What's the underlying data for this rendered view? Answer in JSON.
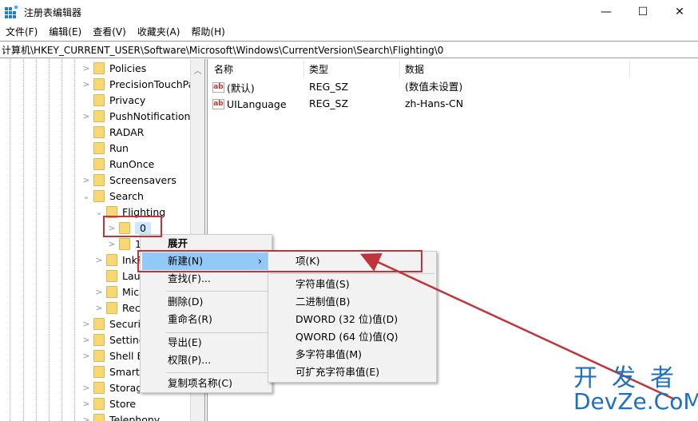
{
  "window": {
    "title": "注册表编辑器",
    "icon": "regedit-icon",
    "controls": {
      "minimize": "—",
      "maximize": "☐",
      "close": "✕"
    }
  },
  "menubar": [
    "文件(F)",
    "编辑(E)",
    "查看(V)",
    "收藏夹(A)",
    "帮助(H)"
  ],
  "address": "计算机\\HKEY_CURRENT_USER\\Software\\Microsoft\\Windows\\CurrentVersion\\Search\\Flighting\\0",
  "tree": {
    "items": [
      {
        "label": "Policies",
        "expander": ">",
        "level": 0
      },
      {
        "label": "PrecisionTouchPa",
        "expander": ">",
        "level": 0
      },
      {
        "label": "Privacy",
        "expander": "",
        "level": 0
      },
      {
        "label": "PushNotifications",
        "expander": ">",
        "level": 0
      },
      {
        "label": "RADAR",
        "expander": "",
        "level": 0
      },
      {
        "label": "Run",
        "expander": "",
        "level": 0
      },
      {
        "label": "RunOnce",
        "expander": "",
        "level": 0
      },
      {
        "label": "Screensavers",
        "expander": ">",
        "level": 0
      },
      {
        "label": "Search",
        "expander": "v",
        "level": 0
      },
      {
        "label": "Flighting",
        "expander": "v",
        "level": 1
      },
      {
        "label": "0",
        "expander": ">",
        "level": 2,
        "selected": true
      },
      {
        "label": "1",
        "expander": ">",
        "level": 2
      },
      {
        "label": "InkR",
        "expander": ">",
        "level": 1
      },
      {
        "label": "Laun",
        "expander": "",
        "level": 1
      },
      {
        "label": "Mic",
        "expander": ">",
        "level": 1
      },
      {
        "label": "Rec",
        "expander": ">",
        "level": 1
      },
      {
        "label": "Securit",
        "expander": ">",
        "level": 0
      },
      {
        "label": "Setting",
        "expander": ">",
        "level": 0
      },
      {
        "label": "Shell E",
        "expander": ">",
        "level": 0
      },
      {
        "label": "SmartG",
        "expander": "",
        "level": 0
      },
      {
        "label": "Storag",
        "expander": ">",
        "level": 0
      },
      {
        "label": "Store",
        "expander": ">",
        "level": 0
      },
      {
        "label": "Telephony",
        "expander": ">",
        "level": 0
      }
    ]
  },
  "list": {
    "columns": [
      "名称",
      "类型",
      "数据"
    ],
    "rows": [
      {
        "icon": "ab",
        "name": "(默认)",
        "type": "REG_SZ",
        "data": "(数值未设置)"
      },
      {
        "icon": "ab",
        "name": "UILanguage",
        "type": "REG_SZ",
        "data": "zh-Hans-CN"
      }
    ]
  },
  "context_menu": {
    "items": [
      "展开",
      "新建(N)",
      "查找(F)...",
      "删除(D)",
      "重命名(R)",
      "导出(E)",
      "权限(P)...",
      "复制项名称(C)"
    ],
    "submenu_arrow": "›"
  },
  "submenu": {
    "items": [
      "项(K)",
      "字符串值(S)",
      "二进制值(B)",
      "DWORD (32 位)值(D)",
      "QWORD (64 位)值(Q)",
      "多字符串值(M)",
      "可扩充字符串值(E)"
    ]
  },
  "watermark": {
    "line1": "开发者",
    "line2": "DevZe.CoM"
  },
  "colors": {
    "highlight": "#91c9f7",
    "annotation": "#c0343c",
    "watermark": "#1f6fbf"
  }
}
